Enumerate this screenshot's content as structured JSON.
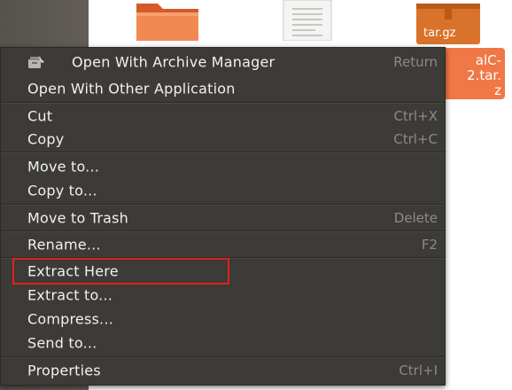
{
  "desktop": {
    "archive_icon_text": "tar.gz",
    "selected_file_label": "alC-\n2.tar.\nz"
  },
  "menu": {
    "items": [
      {
        "label": "Open With Archive Manager",
        "shortcut": "Return",
        "icon": "archive-manager-icon"
      },
      {
        "label": "Open With Other Application",
        "shortcut": ""
      },
      {
        "label": "Cut",
        "shortcut": "Ctrl+X"
      },
      {
        "label": "Copy",
        "shortcut": "Ctrl+C"
      },
      {
        "label": "Move to...",
        "shortcut": ""
      },
      {
        "label": "Copy to...",
        "shortcut": ""
      },
      {
        "label": "Move to Trash",
        "shortcut": "Delete"
      },
      {
        "label": "Rename...",
        "shortcut": "F2"
      },
      {
        "label": "Extract Here",
        "shortcut": ""
      },
      {
        "label": "Extract to...",
        "shortcut": ""
      },
      {
        "label": "Compress...",
        "shortcut": ""
      },
      {
        "label": "Send to...",
        "shortcut": ""
      },
      {
        "label": "Properties",
        "shortcut": "Ctrl+I"
      }
    ]
  },
  "colors": {
    "menu_background": "#3c3b37",
    "menu_text": "#f2f1ef",
    "shortcut_text": "#8d8a83",
    "selection_orange": "#f07746",
    "highlight_red": "#e02020"
  }
}
